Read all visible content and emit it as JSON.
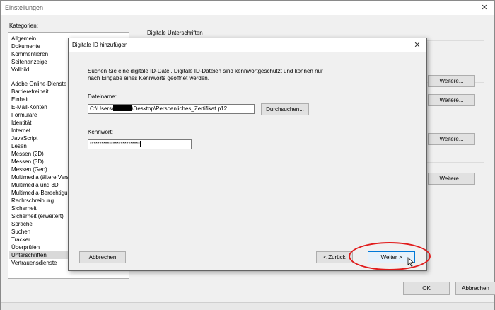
{
  "window": {
    "title": "Einstellungen",
    "close_glyph": "✕"
  },
  "categories_label": "Kategorien:",
  "categories_group1": [
    "Allgemein",
    "Dokumente",
    "Kommentieren",
    "Seitenanzeige",
    "Vollbild"
  ],
  "categories_group2": [
    "Adobe Online-Dienste",
    "Barrierefreiheit",
    "Einheit",
    "E-Mail-Konten",
    "Formulare",
    "Identität",
    "Internet",
    "JavaScript",
    "Lesen",
    "Messen (2D)",
    "Messen (3D)",
    "Messen (Geo)",
    "Multimedia (ältere Versionen)",
    "Multimedia und 3D",
    "Multimedia-Berechtigungen",
    "Rechtschreibung",
    "Sicherheit",
    "Sicherheit (erweitert)",
    "Sprache",
    "Suchen",
    "Tracker",
    "Überprüfen",
    "Unterschriften",
    "Vertrauensdienste"
  ],
  "selected_category": "Unterschriften",
  "right_panel": {
    "heading": "Digitale Unterschriften",
    "more_buttons": [
      "Weitere...",
      "Weitere...",
      "Weitere...",
      "Weitere..."
    ]
  },
  "footer": {
    "ok": "OK",
    "cancel": "Abbrechen"
  },
  "dialog": {
    "title": "Digitale ID hinzufügen",
    "close_glyph": "✕",
    "instruction_line1": "Suchen Sie eine digitale ID-Datei. Digitale ID-Dateien sind kennwortgeschützt und können nur",
    "instruction_line2": "nach Eingabe eines Kennworts geöffnet werden.",
    "filename_label": "Dateiname:",
    "filename_prefix": "C:\\Users\\",
    "filename_suffix": "\\Desktop\\Persoenliches_Zertifikat.p12",
    "browse": "Durchsuchen...",
    "password_label": "Kennwort:",
    "password_value": "**************************",
    "cancel": "Abbrechen",
    "back": "< Zurück",
    "next": "Weiter >"
  },
  "colors": {
    "highlight_ellipse": "#e11b1b",
    "selected_bg": "#d9d9d9"
  }
}
